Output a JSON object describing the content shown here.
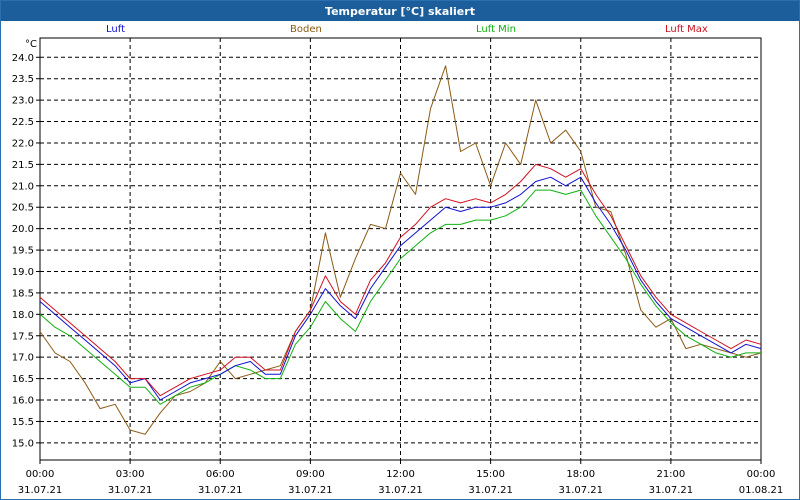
{
  "window": {
    "title": "Temperatur [°C] skaliert"
  },
  "colors": {
    "luft": "#1010d0",
    "boden": "#8b5a14",
    "luft_min": "#10b010",
    "luft_max": "#d01020",
    "grid": "#000000"
  },
  "chart_data": {
    "type": "line",
    "title": "Temperatur [°C] skaliert",
    "ylabel": "°C",
    "ylim": [
      14.6,
      24.45
    ],
    "yticks": [
      "15.0",
      "15.5",
      "16.0",
      "16.5",
      "17.0",
      "17.5",
      "18.0",
      "18.5",
      "19.0",
      "19.5",
      "20.0",
      "20.5",
      "21.0",
      "21.5",
      "22.0",
      "22.5",
      "23.0",
      "23.5",
      "24.0"
    ],
    "xlim": [
      0,
      24
    ],
    "xticks": [
      {
        "time": "00:00",
        "date": "31.07.21"
      },
      {
        "time": "03:00",
        "date": "31.07.21"
      },
      {
        "time": "06:00",
        "date": "31.07.21"
      },
      {
        "time": "09:00",
        "date": "31.07.21"
      },
      {
        "time": "12:00",
        "date": "31.07.21"
      },
      {
        "time": "15:00",
        "date": "31.07.21"
      },
      {
        "time": "18:00",
        "date": "31.07.21"
      },
      {
        "time": "21:00",
        "date": "31.07.21"
      },
      {
        "time": "00:00",
        "date": "01.08.21"
      }
    ],
    "grid": true,
    "legend_position": "top",
    "series": [
      {
        "name": "Luft",
        "color": "#1010d0",
        "x": [
          0,
          0.5,
          1,
          1.5,
          2,
          2.5,
          3,
          3.5,
          4,
          4.5,
          5,
          5.5,
          6,
          6.5,
          7,
          7.5,
          8,
          8.5,
          9,
          9.5,
          10,
          10.5,
          11,
          11.5,
          12,
          12.5,
          13,
          13.5,
          14,
          14.5,
          15,
          15.5,
          16,
          16.5,
          17,
          17.5,
          18,
          18.5,
          19,
          19.5,
          20,
          20.5,
          21,
          21.5,
          22,
          22.5,
          23,
          23.5,
          24
        ],
        "y": [
          18.3,
          18.0,
          17.7,
          17.4,
          17.1,
          16.8,
          16.4,
          16.5,
          16.0,
          16.2,
          16.4,
          16.5,
          16.6,
          16.8,
          16.9,
          16.6,
          16.6,
          17.5,
          18.0,
          18.6,
          18.2,
          17.9,
          18.6,
          19.1,
          19.6,
          19.9,
          20.2,
          20.5,
          20.4,
          20.5,
          20.5,
          20.6,
          20.8,
          21.1,
          21.2,
          21.0,
          21.2,
          20.6,
          20.1,
          19.5,
          18.8,
          18.3,
          17.9,
          17.7,
          17.5,
          17.3,
          17.1,
          17.3,
          17.2
        ]
      },
      {
        "name": "Boden",
        "color": "#8b5a14",
        "x": [
          0,
          0.5,
          1,
          1.5,
          2,
          2.5,
          3,
          3.5,
          4,
          4.5,
          5,
          5.5,
          6,
          6.5,
          7,
          7.5,
          8,
          8.5,
          9,
          9.5,
          10,
          10.5,
          11,
          11.5,
          12,
          12.5,
          13,
          13.5,
          14,
          14.5,
          15,
          15.5,
          16,
          16.5,
          17,
          17.5,
          18,
          18.5,
          19,
          19.5,
          20,
          20.5,
          21,
          21.5,
          22,
          22.5,
          23,
          23.5,
          24
        ],
        "y": [
          17.6,
          17.1,
          16.9,
          16.4,
          15.8,
          15.9,
          15.3,
          15.2,
          15.7,
          16.1,
          16.2,
          16.4,
          16.9,
          16.5,
          16.6,
          16.7,
          16.8,
          17.6,
          18.1,
          19.9,
          18.4,
          19.3,
          20.1,
          20.0,
          21.3,
          20.8,
          22.8,
          23.8,
          21.8,
          22.0,
          21.0,
          22.0,
          21.5,
          23.0,
          22.0,
          22.3,
          21.8,
          20.5,
          20.4,
          19.4,
          18.1,
          17.7,
          17.9,
          17.2,
          17.3,
          17.2,
          17.1,
          17.0,
          17.1
        ]
      },
      {
        "name": "Luft Min",
        "color": "#10b010",
        "x": [
          0,
          0.5,
          1,
          1.5,
          2,
          2.5,
          3,
          3.5,
          4,
          4.5,
          5,
          5.5,
          6,
          6.5,
          7,
          7.5,
          8,
          8.5,
          9,
          9.5,
          10,
          10.5,
          11,
          11.5,
          12,
          12.5,
          13,
          13.5,
          14,
          14.5,
          15,
          15.5,
          16,
          16.5,
          17,
          17.5,
          18,
          18.5,
          19,
          19.5,
          20,
          20.5,
          21,
          21.5,
          22,
          22.5,
          23,
          23.5,
          24
        ],
        "y": [
          18.0,
          17.7,
          17.5,
          17.2,
          16.9,
          16.6,
          16.3,
          16.3,
          15.9,
          16.1,
          16.3,
          16.4,
          16.6,
          16.8,
          16.7,
          16.5,
          16.5,
          17.3,
          17.7,
          18.3,
          17.9,
          17.6,
          18.3,
          18.8,
          19.3,
          19.6,
          19.9,
          20.1,
          20.1,
          20.2,
          20.2,
          20.3,
          20.5,
          20.9,
          20.9,
          20.8,
          20.9,
          20.3,
          19.8,
          19.3,
          18.7,
          18.2,
          17.8,
          17.5,
          17.3,
          17.1,
          17.0,
          17.1,
          17.1
        ]
      },
      {
        "name": "Luft Max",
        "color": "#d01020",
        "x": [
          0,
          0.5,
          1,
          1.5,
          2,
          2.5,
          3,
          3.5,
          4,
          4.5,
          5,
          5.5,
          6,
          6.5,
          7,
          7.5,
          8,
          8.5,
          9,
          9.5,
          10,
          10.5,
          11,
          11.5,
          12,
          12.5,
          13,
          13.5,
          14,
          14.5,
          15,
          15.5,
          16,
          16.5,
          17,
          17.5,
          18,
          18.5,
          19,
          19.5,
          20,
          20.5,
          21,
          21.5,
          22,
          22.5,
          23,
          23.5,
          24
        ],
        "y": [
          18.4,
          18.1,
          17.8,
          17.5,
          17.2,
          16.9,
          16.5,
          16.5,
          16.1,
          16.3,
          16.5,
          16.6,
          16.7,
          17.0,
          17.0,
          16.7,
          16.7,
          17.6,
          18.1,
          18.9,
          18.3,
          18.0,
          18.8,
          19.2,
          19.8,
          20.1,
          20.5,
          20.7,
          20.6,
          20.7,
          20.6,
          20.8,
          21.1,
          21.5,
          21.4,
          21.2,
          21.4,
          20.8,
          20.3,
          19.6,
          18.9,
          18.4,
          18.0,
          17.8,
          17.6,
          17.4,
          17.2,
          17.4,
          17.3
        ]
      }
    ]
  }
}
